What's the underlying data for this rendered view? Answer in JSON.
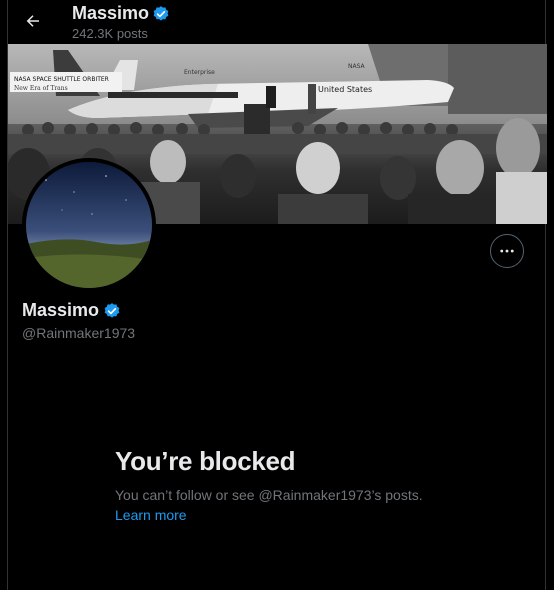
{
  "header": {
    "display_name": "Massimo",
    "post_count": "242.3K posts",
    "back_icon": "arrow-left-icon",
    "verified_icon": "verified-badge-icon"
  },
  "banner": {
    "sign_text": "NASA SPACE SHUTTLE ORBITER",
    "sign_subtext": "New Era of Trans",
    "orbiter_name": "Enterprise",
    "fuselage_text": "United States",
    "tail_text": "NASA"
  },
  "profile": {
    "display_name": "Massimo",
    "handle": "@Rainmaker1973",
    "more_icon": "more-options-icon"
  },
  "blocked": {
    "title": "You’re blocked",
    "message": "You can’t follow or see @Rainmaker1973’s posts.",
    "link": "Learn more"
  },
  "colors": {
    "background": "#000000",
    "primary_text": "#e7e9ea",
    "secondary_text": "#71767b",
    "link": "#1d9bf0",
    "verified": "#1d9bf0"
  }
}
